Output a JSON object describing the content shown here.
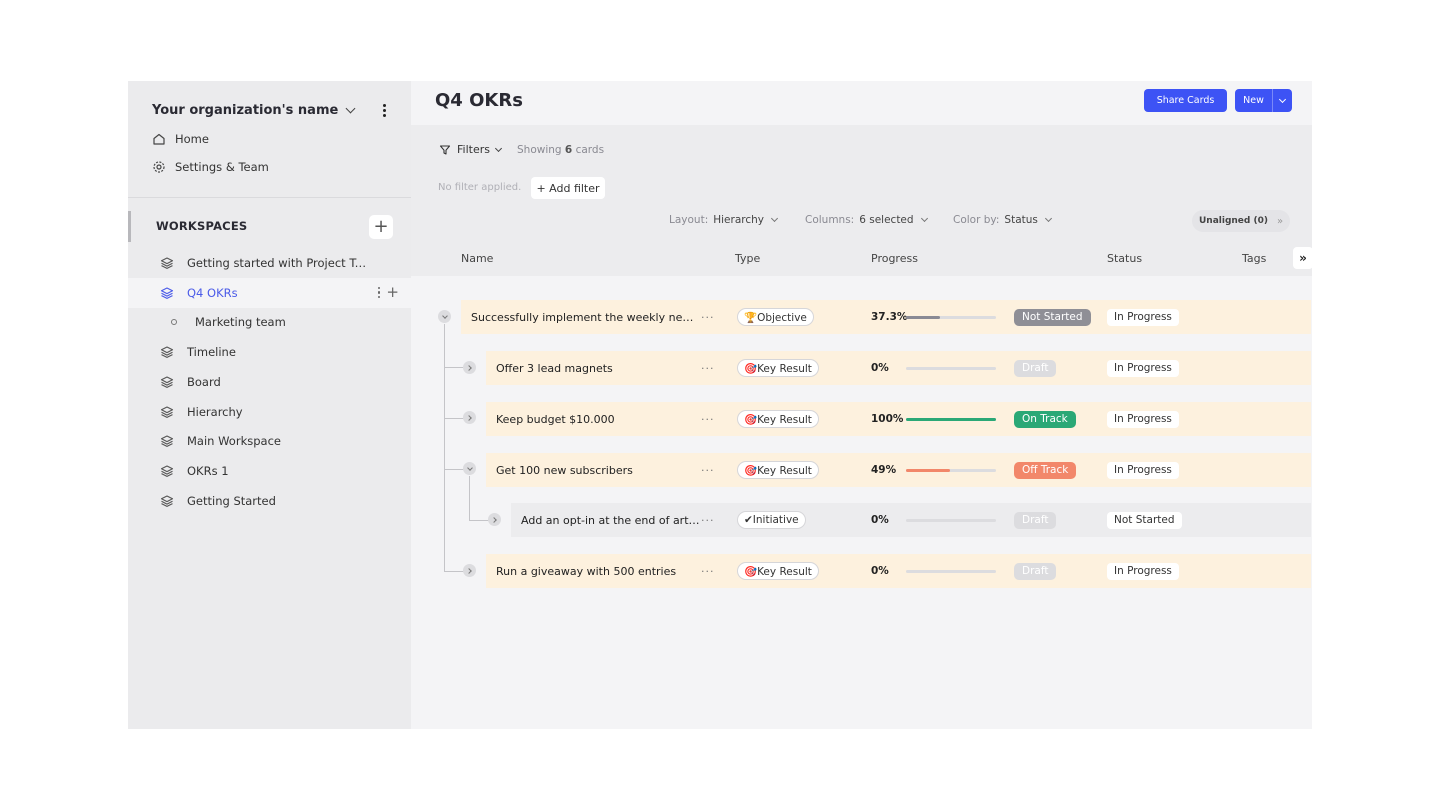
{
  "org": {
    "name": "Your organization's name"
  },
  "nav": {
    "home": "Home",
    "settings": "Settings & Team"
  },
  "workspaces": {
    "header": "WORKSPACES",
    "add_label": "+",
    "items": [
      {
        "label": "Getting started with Project Trac...",
        "icon": "layers-icon"
      },
      {
        "label": "Q4 OKRs",
        "icon": "layers-icon",
        "active": true
      },
      {
        "label": "Marketing team",
        "icon": "circle-icon"
      },
      {
        "label": "Timeline",
        "icon": "layers-icon"
      },
      {
        "label": "Board",
        "icon": "layers-icon"
      },
      {
        "label": "Hierarchy",
        "icon": "layers-icon"
      },
      {
        "label": "Main Workspace",
        "icon": "layers-icon"
      },
      {
        "label": "OKRs 1",
        "icon": "layers-icon"
      },
      {
        "label": "Getting Started",
        "icon": "layers-icon"
      }
    ]
  },
  "page": {
    "title": "Q4 OKRs",
    "share_label": "Share Cards",
    "new_label": "New"
  },
  "filters": {
    "label": "Filters",
    "showing_prefix": "Showing",
    "showing_count": "6",
    "showing_suffix": "cards",
    "no_filter": "No filter applied.",
    "add_filter": "+ Add filter"
  },
  "view": {
    "layout_label": "Layout:",
    "layout_value": "Hierarchy",
    "columns_label": "Columns:",
    "columns_value": "6 selected",
    "color_label": "Color by:",
    "color_value": "Status",
    "unaligned": "Unaligned (0)",
    "unaligned_arrow": "»"
  },
  "columns": [
    "Name",
    "Type",
    "Progress",
    "Status",
    "Tags"
  ],
  "expand_label": "»",
  "rows": [
    {
      "title": "Successfully implement the weekly newsle...",
      "dots": "···",
      "type": "🏆Objective",
      "pct": "37.3%",
      "progress": 0.373,
      "bar_color": "#8a8a94",
      "badge": "Not Started",
      "badge_bg": "#8f8f96",
      "badge_fg": "#ffffff",
      "status": "In Progress"
    },
    {
      "title": "Offer 3 lead magnets",
      "dots": "···",
      "type": "🎯Key Result",
      "pct": "0%",
      "progress": 0,
      "bar_color": "#8a8a94",
      "badge": "Draft",
      "badge_bg": "#dcdcdf",
      "badge_fg": "#ffffff",
      "status": "In Progress"
    },
    {
      "title": "Keep budget $10.000",
      "dots": "···",
      "type": "🎯Key Result",
      "pct": "100%",
      "progress": 1.0,
      "bar_color": "#2aa876",
      "badge": "On Track",
      "badge_bg": "#2aa876",
      "badge_fg": "#ffffff",
      "status": "In Progress"
    },
    {
      "title": "Get 100 new subscribers",
      "dots": "···",
      "type": "🎯Key Result",
      "pct": "49%",
      "progress": 0.49,
      "bar_color": "#f2876a",
      "badge": "Off Track",
      "badge_bg": "#f2876a",
      "badge_fg": "#ffffff",
      "status": "In Progress"
    },
    {
      "title": "Add an opt-in at the end of artic...",
      "dots": "···",
      "type": "✔Initiative",
      "pct": "0%",
      "progress": 0,
      "bar_color": "#8a8a94",
      "badge": "Draft",
      "badge_bg": "#dcdcdf",
      "badge_fg": "#ffffff",
      "status": "Not Started"
    },
    {
      "title": "Run a giveaway with 500 entries",
      "dots": "···",
      "type": "🎯Key Result",
      "pct": "0%",
      "progress": 0,
      "bar_color": "#8a8a94",
      "badge": "Draft",
      "badge_bg": "#dcdcdf",
      "badge_fg": "#ffffff",
      "status": "In Progress"
    }
  ]
}
